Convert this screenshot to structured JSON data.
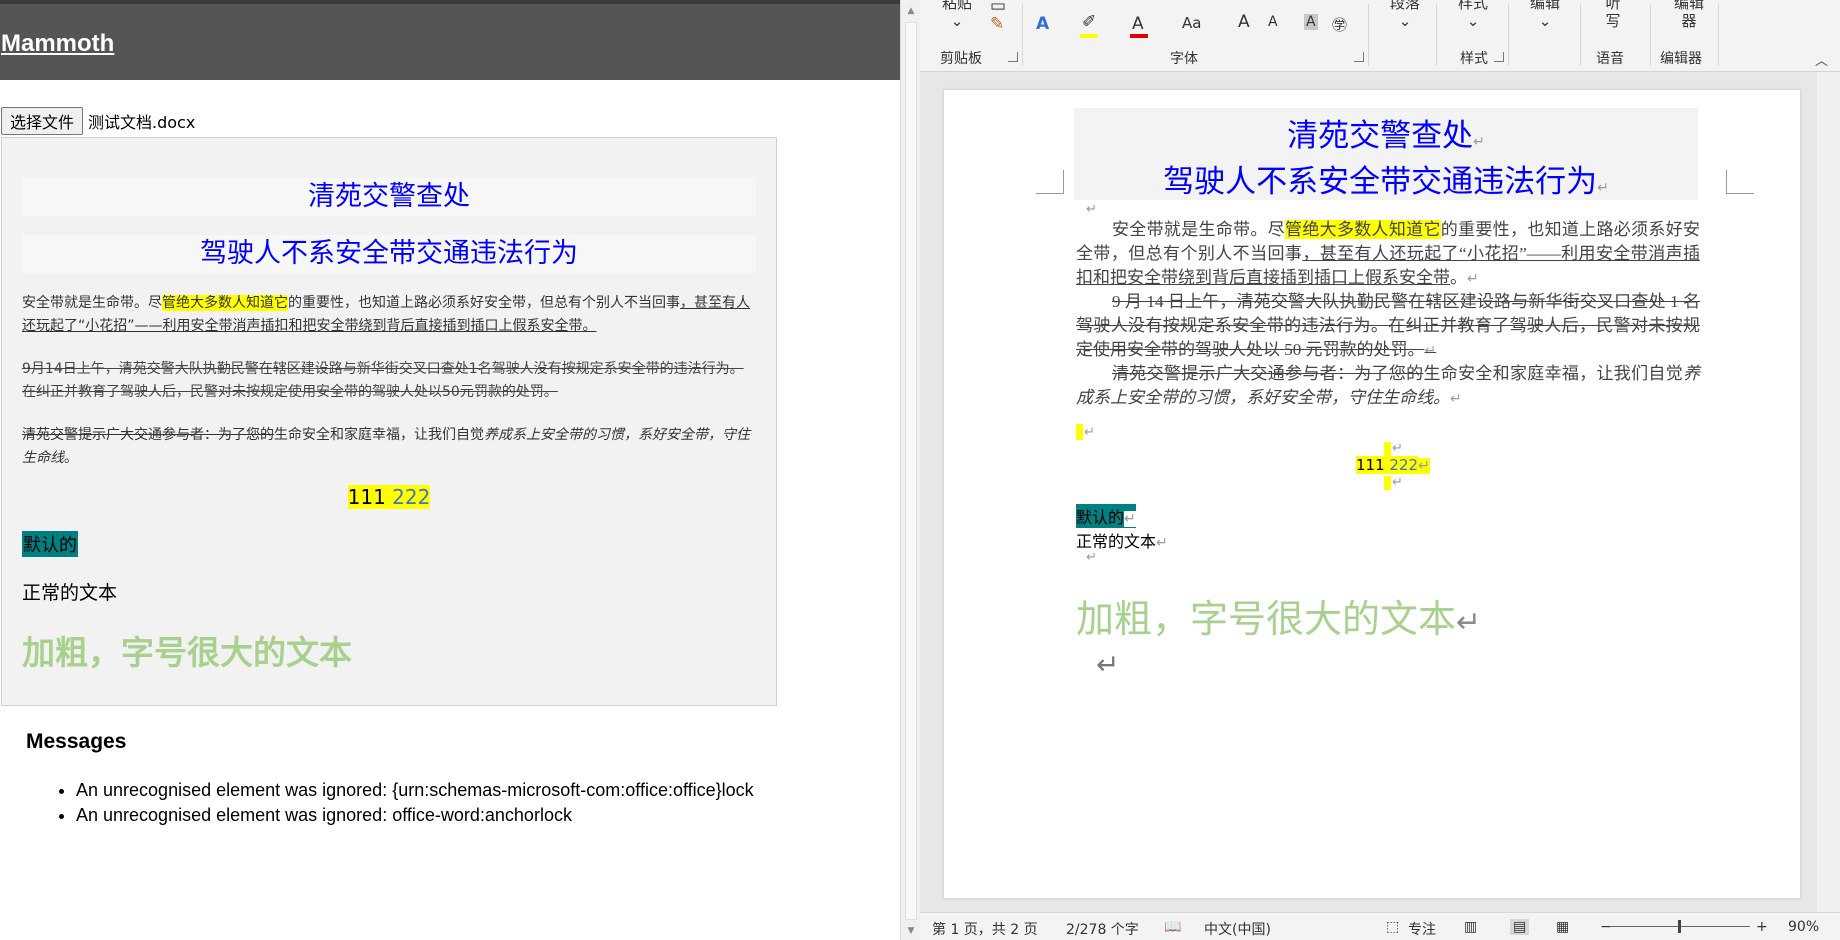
{
  "left_app": {
    "title": "Mammoth",
    "file_button_label": "选择文件",
    "file_name": "测试文档.docx",
    "preview": {
      "heading1": "清苑交警查处",
      "heading2": "驾驶人不系安全带交通违法行为",
      "p1_a": "安全带就是生命带。尽",
      "p1_hl": "管绝大多数人知道它",
      "p1_b": "的重要性，也知道上路必须系好安全带，但总有个别人不当回事",
      "p1_u": "，甚至有人还玩起了“小花招”——利用安全带消声插扣和把安全带绕到背后直接插到插口上假系安全带。",
      "p2": "9月14日上午，清苑交警大队执勤民警在辖区建设路与新华街交叉口查处1名驾驶人没有按规定系安全带的违法行为。在纠正并教育了驾驶人后，民警对未按规定使用安全带的驾驶人处以50元罚款的处罚。",
      "p3_strike": "清苑交警提示广大交通参与者：为了您的",
      "p3_a": "生命安全和家庭幸福，让我们自觉",
      "p3_ital": "养成系上安全带的习惯，系好安全带，守住生命线",
      "p3_end": "。",
      "num1": "111",
      "num2": "222",
      "default_text": "默认的",
      "normal_text": "正常的文本",
      "big_text": "加粗，字号很大的文本"
    },
    "messages": {
      "title": "Messages",
      "items": [
        "An unrecognised element was ignored: {urn:schemas-microsoft-com:office:office}lock",
        "An unrecognised element was ignored: office-word:anchorlock"
      ]
    }
  },
  "word": {
    "ribbon": {
      "paste_label": "粘贴",
      "clipboard_label": "剪贴板",
      "font_label": "字体",
      "paragraph_label": "段落",
      "styles_btn_label": "样式",
      "styles_label": "样式",
      "edit_label": "编辑",
      "listen_label": "听写",
      "voice_label": "语音",
      "editor_btn_label": "编辑器",
      "editor_label": "编辑器",
      "font_case_label": "Aa",
      "grow_font_label": "A",
      "shrink_font_label": "A"
    },
    "document": {
      "heading1": "清苑交警查处",
      "heading2": "驾驶人不系安全带交通违法行为",
      "p1_a": "安全带就是生命带。尽",
      "p1_hl": "管绝大多数人知道它",
      "p1_b": "的重要性，也知道上路必须系好安全带，但总有个别人不当回事",
      "p1_u": "，甚至有人还玩起了“小花招”——利用安全带消声插扣和把安全带绕到背后直接插到插口上假系安全带",
      "p1_end": "。",
      "p2": "9 月 14 日上午，清苑交警大队执勤民警在辖区建设路与新华街交叉口查处 1 名驾驶人没有按规定系安全带的违法行为。在纠正并教育了驾驶人后，民警对未按规定使用安全带的驾驶人处以 50 元罚款的处罚。",
      "p3_strike": "清苑交警提示广大交通参与者：为了您的",
      "p3_a": "生命安全和家庭幸福，让我们自觉",
      "p3_ital": "养成系上安全带的习惯，系好安全带，守住生命线。",
      "num1": "111",
      "num2": "222",
      "default_text": "默认的",
      "normal_text": "正常的文本",
      "big_text": "加粗，字号很大的文本",
      "para_mark": "↵"
    },
    "status": {
      "page": "第 1 页，共 2 页",
      "words": "2/278 个字",
      "language": "中文(中国)",
      "focus": "专注",
      "zoom": "90%",
      "zoom_minus": "−",
      "zoom_plus": "+"
    }
  }
}
